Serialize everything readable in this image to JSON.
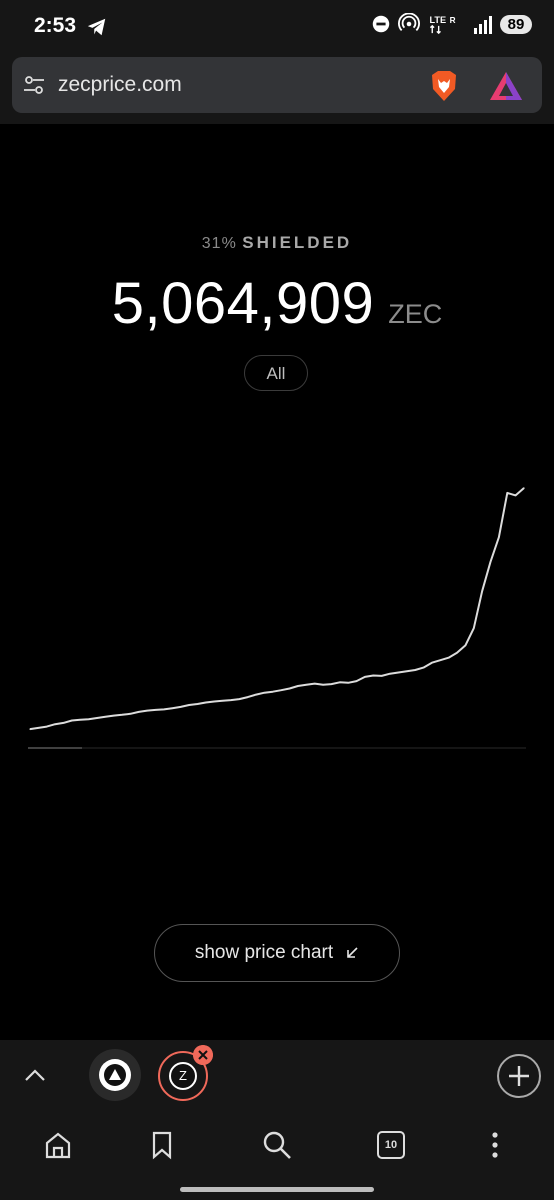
{
  "status_bar": {
    "time": "2:53",
    "network": "LTE",
    "battery": "89"
  },
  "browser": {
    "url": "zecprice.com",
    "open_tabs": "10",
    "tab_letter": "Z"
  },
  "shielded": {
    "percent": "31%",
    "label": "SHIELDED",
    "amount": "5,064,909",
    "unit": "ZEC",
    "range": "All"
  },
  "price_chart_button": {
    "label": "show price chart"
  },
  "chart_data": {
    "type": "line",
    "series": [
      {
        "values": [
          0.02,
          0.025,
          0.03,
          0.04,
          0.045,
          0.055,
          0.058,
          0.06,
          0.065,
          0.07,
          0.075,
          0.078,
          0.082,
          0.09,
          0.095,
          0.098,
          0.1,
          0.105,
          0.11,
          0.118,
          0.122,
          0.128,
          0.132,
          0.135,
          0.138,
          0.142,
          0.15,
          0.16,
          0.168,
          0.172,
          0.178,
          0.185,
          0.195,
          0.2,
          0.205,
          0.2,
          0.203,
          0.21,
          0.208,
          0.215,
          0.232,
          0.238,
          0.236,
          0.245,
          0.25,
          0.255,
          0.26,
          0.27,
          0.29,
          0.3,
          0.31,
          0.33,
          0.36,
          0.43,
          0.58,
          0.7,
          0.8,
          0.98,
          0.97,
          1.0
        ]
      }
    ],
    "colors": {
      "line": "#dcdcdc",
      "background": "#000000"
    },
    "grid": false,
    "legend": "none"
  },
  "colors": {
    "accent": "#f0695a",
    "background": "#000000"
  }
}
